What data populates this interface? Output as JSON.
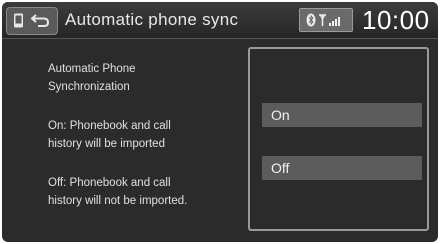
{
  "header": {
    "title": "Automatic phone sync",
    "clock": "10:00",
    "icons": [
      "phone-icon",
      "back-icon",
      "bluetooth-icon",
      "signal-icon"
    ]
  },
  "description": {
    "heading_line1": "Automatic Phone",
    "heading_line2": "Synchronization",
    "on_line1": "On: Phonebook and call",
    "on_line2": "history will be imported",
    "off_line1": "Off: Phonebook and call",
    "off_line2": "history will not be imported."
  },
  "options": {
    "on_label": "On",
    "off_label": "Off"
  },
  "colors": {
    "screen_bg": "#2b2b2b",
    "option_bg": "#5c5c5c",
    "text": "#e0e0e0"
  }
}
